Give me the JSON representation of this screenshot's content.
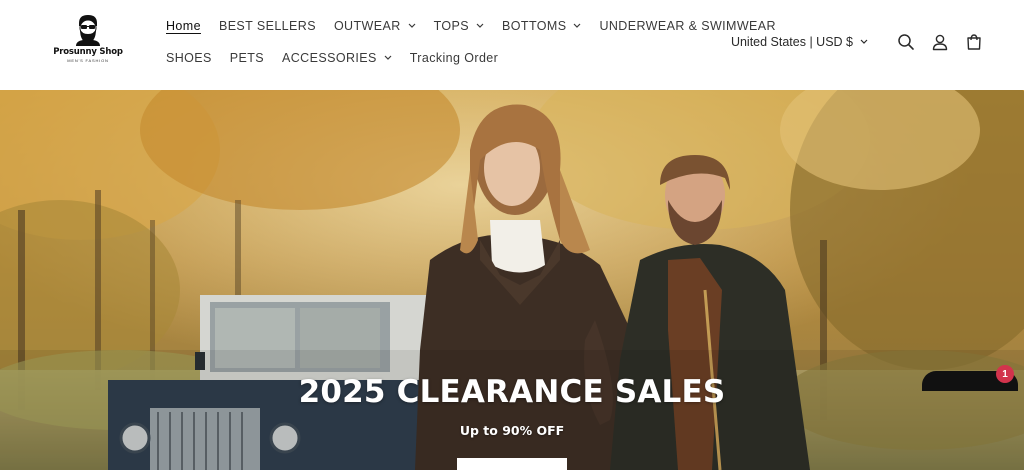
{
  "brand": {
    "name": "Prosunny Shop",
    "tagline": "MEN'S FASHION"
  },
  "nav": {
    "row1": [
      {
        "label": "Home",
        "active": true,
        "dropdown": false
      },
      {
        "label": "BEST SELLERS",
        "active": false,
        "dropdown": false
      },
      {
        "label": "OUTWEAR",
        "active": false,
        "dropdown": true
      },
      {
        "label": "TOPS",
        "active": false,
        "dropdown": true
      },
      {
        "label": "BOTTOMS",
        "active": false,
        "dropdown": true
      },
      {
        "label": "UNDERWEAR & SWIMWEAR",
        "active": false,
        "dropdown": false
      }
    ],
    "row2": [
      {
        "label": "SHOES",
        "active": false,
        "dropdown": false
      },
      {
        "label": "PETS",
        "active": false,
        "dropdown": false
      },
      {
        "label": "ACCESSORIES",
        "active": false,
        "dropdown": true
      },
      {
        "label": "Tracking Order",
        "active": false,
        "dropdown": false
      }
    ]
  },
  "locale": {
    "label": "United States | USD $"
  },
  "icons": {
    "search": "search-icon",
    "account": "account-icon",
    "cart": "cart-icon",
    "dropdown": "chevron-down-icon"
  },
  "hero": {
    "title": "2025 CLEARANCE SALES",
    "subtitle": "Up to 90% OFF"
  },
  "chat": {
    "badge_count": "1"
  },
  "colors": {
    "text": "#2a2a2a",
    "hero_text": "#ffffff",
    "badge": "#d2334c"
  }
}
